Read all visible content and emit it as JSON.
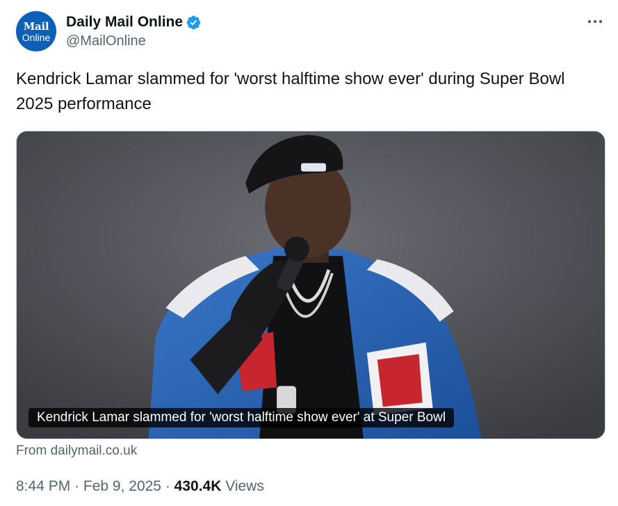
{
  "author": {
    "display_name": "Daily Mail Online",
    "handle": "@MailOnline",
    "avatar_top": "Mail",
    "avatar_bottom": "Online",
    "verified": true,
    "brand_color": "#0a61b5",
    "verified_color": "#1d9bf0"
  },
  "tweet": {
    "text": "Kendrick Lamar slammed for 'worst halftime show ever' during Super Bowl 2025 performance"
  },
  "media": {
    "caption": "Kendrick Lamar slammed for 'worst halftime show ever' at Super Bowl",
    "source": "From dailymail.co.uk"
  },
  "meta": {
    "time": "8:44 PM",
    "separator": " · ",
    "date": "Feb 9, 2025",
    "views_count": "430.4K",
    "views_label": " Views"
  },
  "icons": {
    "verified": "verified-badge-icon",
    "more": "more-horizontal-icon"
  }
}
